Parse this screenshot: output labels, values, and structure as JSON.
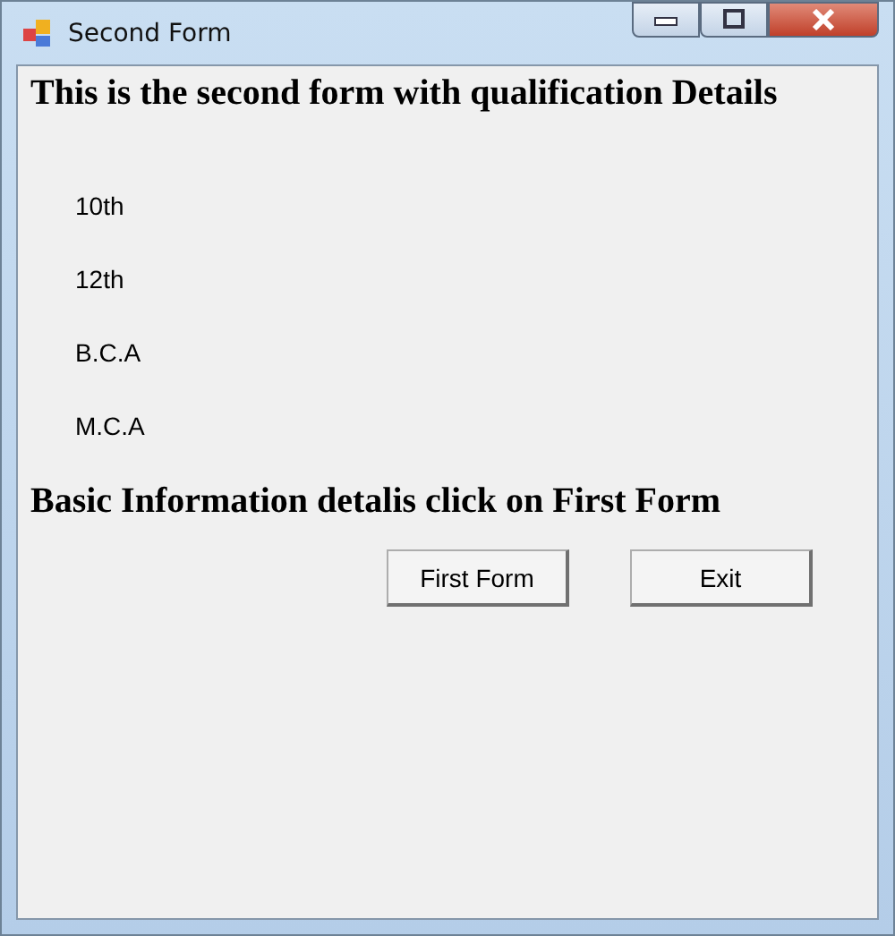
{
  "window": {
    "title": "Second Form"
  },
  "heading": "This is the second form with qualification Details",
  "qualifications": [
    "10th",
    "12th",
    "B.C.A",
    "M.C.A"
  ],
  "info_text": "Basic Information detalis click on First Form",
  "buttons": [
    "First Form",
    "Exit"
  ]
}
